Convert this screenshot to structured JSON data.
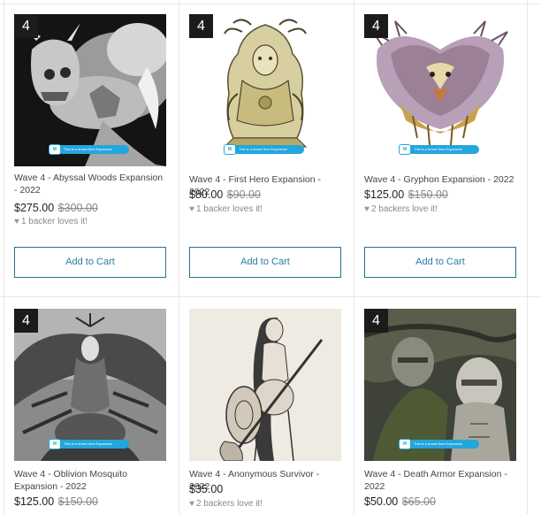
{
  "products": [
    {
      "badge": "4",
      "title": "Wave 4 - Abyssal Woods Expansion - 2022",
      "price": "$275.00",
      "old_price": "$300.00",
      "loves": "1 backer loves it!",
      "cart_label": "Add to Cart",
      "banner_text": "This is a brand New Expansion",
      "banner_logo": "M"
    },
    {
      "badge": "4",
      "title": "Wave 4 - First Hero Expansion - 2022",
      "price": "$80.00",
      "old_price": "$90.00",
      "loves": "1 backer loves it!",
      "cart_label": "Add to Cart",
      "banner_text": "This is a brand New Expansion",
      "banner_logo": "M"
    },
    {
      "badge": "4",
      "title": "Wave 4 - Gryphon Expansion - 2022",
      "price": "$125.00",
      "old_price": "$150.00",
      "loves": "2 backers love it!",
      "cart_label": "Add to Cart",
      "banner_text": "This is a brand New Expansion",
      "banner_logo": "M"
    },
    {
      "badge": "4",
      "title": "Wave 4 - Oblivion Mosquito Expansion - 2022",
      "price": "$125.00",
      "old_price": "$150.00",
      "banner_text": "This is a brand New Expansion",
      "banner_logo": "M"
    },
    {
      "badge": "",
      "title": "Wave 4 - Anonymous Survivor - 2022",
      "price": "$35.00",
      "old_price": "",
      "loves": "2 backers love it!"
    },
    {
      "badge": "4",
      "title": "Wave 4 - Death Armor Expansion - 2022",
      "price": "$50.00",
      "old_price": "$65.00",
      "banner_text": "This is a brand New Expansion",
      "banner_logo": "M"
    }
  ],
  "icons": {
    "love": "heart-icon"
  }
}
